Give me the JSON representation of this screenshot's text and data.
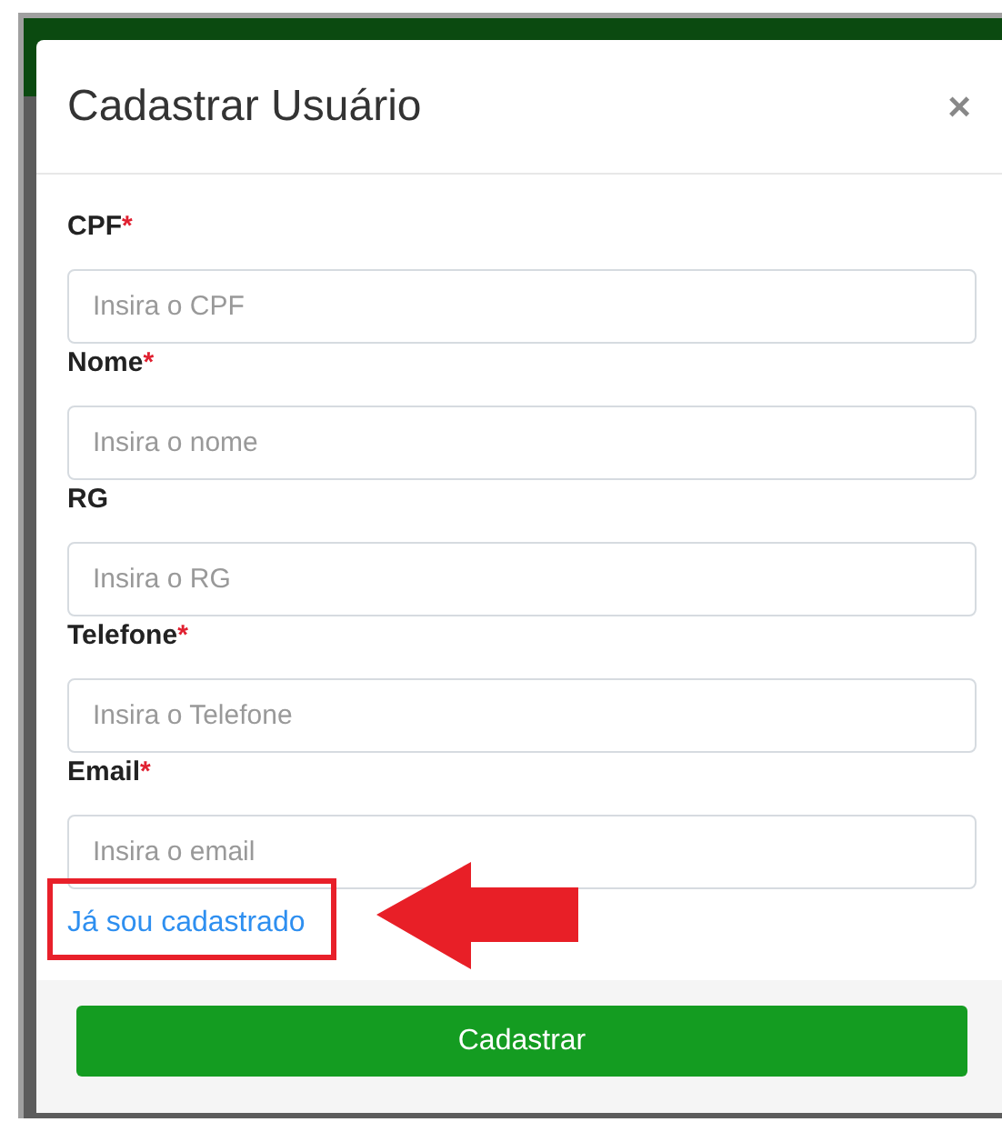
{
  "modal": {
    "title": "Cadastrar Usuário",
    "close": "×"
  },
  "fields": [
    {
      "label": "CPF",
      "required_mark": "*",
      "placeholder": "Insira o CPF"
    },
    {
      "label": "Nome",
      "required_mark": "*",
      "placeholder": "Insira o nome"
    },
    {
      "label": "RG",
      "placeholder": "Insira o RG"
    },
    {
      "label": "Telefone",
      "required_mark": "*",
      "placeholder": "Insira o Telefone"
    },
    {
      "label": "Email",
      "required_mark": "*",
      "placeholder": "Insira o email"
    }
  ],
  "link": "Já sou cadastrado",
  "submit": "Cadastrar"
}
